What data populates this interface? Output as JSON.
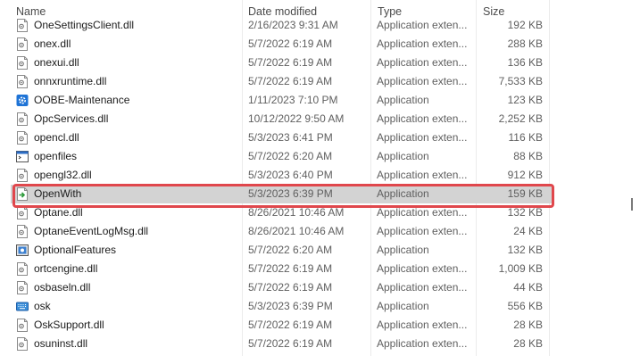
{
  "columns": {
    "name": "Name",
    "date": "Date modified",
    "type": "Type",
    "size": "Size"
  },
  "files": [
    {
      "name": "OneSettingsClient.dll",
      "date": "2/16/2023 9:31 AM",
      "type": "Application exten...",
      "size": "192 KB",
      "icon": "dll-file-icon",
      "selected": false
    },
    {
      "name": "onex.dll",
      "date": "5/7/2022 6:19 AM",
      "type": "Application exten...",
      "size": "288 KB",
      "icon": "dll-file-icon",
      "selected": false
    },
    {
      "name": "onexui.dll",
      "date": "5/7/2022 6:19 AM",
      "type": "Application exten...",
      "size": "136 KB",
      "icon": "dll-file-icon",
      "selected": false
    },
    {
      "name": "onnxruntime.dll",
      "date": "5/7/2022 6:19 AM",
      "type": "Application exten...",
      "size": "7,533 KB",
      "icon": "dll-file-icon",
      "selected": false
    },
    {
      "name": "OOBE-Maintenance",
      "date": "1/11/2023 7:10 PM",
      "type": "Application",
      "size": "123 KB",
      "icon": "gear-app-icon",
      "selected": false
    },
    {
      "name": "OpcServices.dll",
      "date": "10/12/2022 9:50 AM",
      "type": "Application exten...",
      "size": "2,252 KB",
      "icon": "dll-file-icon",
      "selected": false
    },
    {
      "name": "opencl.dll",
      "date": "5/3/2023 6:41 PM",
      "type": "Application exten...",
      "size": "116 KB",
      "icon": "dll-file-icon",
      "selected": false
    },
    {
      "name": "openfiles",
      "date": "5/7/2022 6:20 AM",
      "type": "Application",
      "size": "88 KB",
      "icon": "console-app-icon",
      "selected": false
    },
    {
      "name": "opengl32.dll",
      "date": "5/3/2023 6:40 PM",
      "type": "Application exten...",
      "size": "912 KB",
      "icon": "dll-file-icon",
      "selected": false
    },
    {
      "name": "OpenWith",
      "date": "5/3/2023 6:39 PM",
      "type": "Application",
      "size": "159 KB",
      "icon": "open-with-icon",
      "selected": true
    },
    {
      "name": "Optane.dll",
      "date": "8/26/2021 10:46 AM",
      "type": "Application exten...",
      "size": "132 KB",
      "icon": "dll-file-icon",
      "selected": false
    },
    {
      "name": "OptaneEventLogMsg.dll",
      "date": "8/26/2021 10:46 AM",
      "type": "Application exten...",
      "size": "24 KB",
      "icon": "dll-file-icon",
      "selected": false
    },
    {
      "name": "OptionalFeatures",
      "date": "5/7/2022 6:20 AM",
      "type": "Application",
      "size": "132 KB",
      "icon": "optional-features-icon",
      "selected": false
    },
    {
      "name": "ortcengine.dll",
      "date": "5/7/2022 6:19 AM",
      "type": "Application exten...",
      "size": "1,009 KB",
      "icon": "dll-file-icon",
      "selected": false
    },
    {
      "name": "osbaseln.dll",
      "date": "5/7/2022 6:19 AM",
      "type": "Application exten...",
      "size": "44 KB",
      "icon": "dll-file-icon",
      "selected": false
    },
    {
      "name": "osk",
      "date": "5/3/2023 6:39 PM",
      "type": "Application",
      "size": "556 KB",
      "icon": "keyboard-icon",
      "selected": false
    },
    {
      "name": "OskSupport.dll",
      "date": "5/7/2022 6:19 AM",
      "type": "Application exten...",
      "size": "28 KB",
      "icon": "dll-file-icon",
      "selected": false
    },
    {
      "name": "osuninst.dll",
      "date": "5/7/2022 6:19 AM",
      "type": "Application exten...",
      "size": "28 KB",
      "icon": "dll-file-icon",
      "selected": false
    }
  ],
  "colors": {
    "highlight": "#e0474c",
    "selected_row": "#d3d3d3"
  }
}
